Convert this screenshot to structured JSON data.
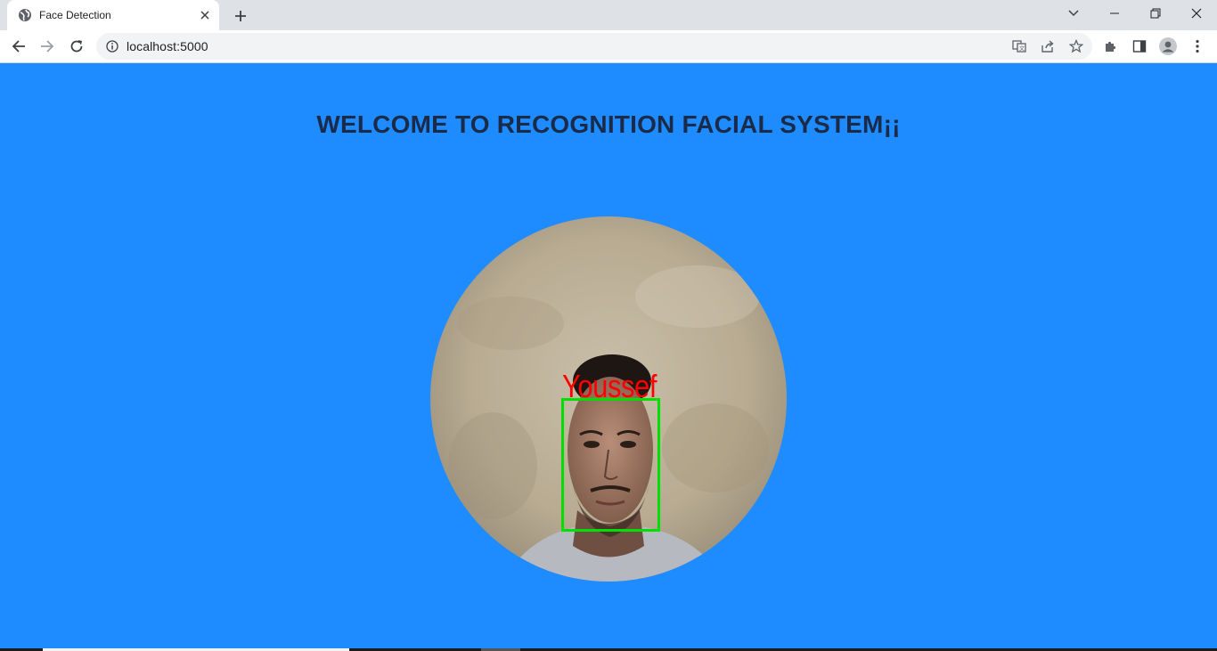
{
  "browser": {
    "tab": {
      "title": "Face Detection"
    },
    "address": {
      "url": "localhost:5000"
    },
    "icons": {
      "favicon": "globe-icon",
      "close": "close-icon",
      "new_tab": "plus-icon",
      "tab_search": "chevron-down-icon",
      "minimize": "minimize-icon",
      "restore": "restore-icon",
      "window_close": "close-icon",
      "back": "arrow-left-icon",
      "forward": "arrow-right-icon",
      "reload": "reload-icon",
      "site_info": "info-icon",
      "translate": "translate-icon",
      "share": "share-icon",
      "bookmark": "star-icon",
      "extensions": "puzzle-icon",
      "side_panel": "side-panel-icon",
      "profile": "profile-icon",
      "menu": "more-vert-icon"
    }
  },
  "page": {
    "heading": "WELCOME TO RECOGNITION FACIAL SYSTEM¡¡",
    "detection": {
      "label": "Youssef"
    }
  },
  "colors": {
    "page_background": "#1e8cff",
    "heading_text": "#1a2b4a",
    "face_label": "#ff0000",
    "face_box": "#00e000"
  }
}
